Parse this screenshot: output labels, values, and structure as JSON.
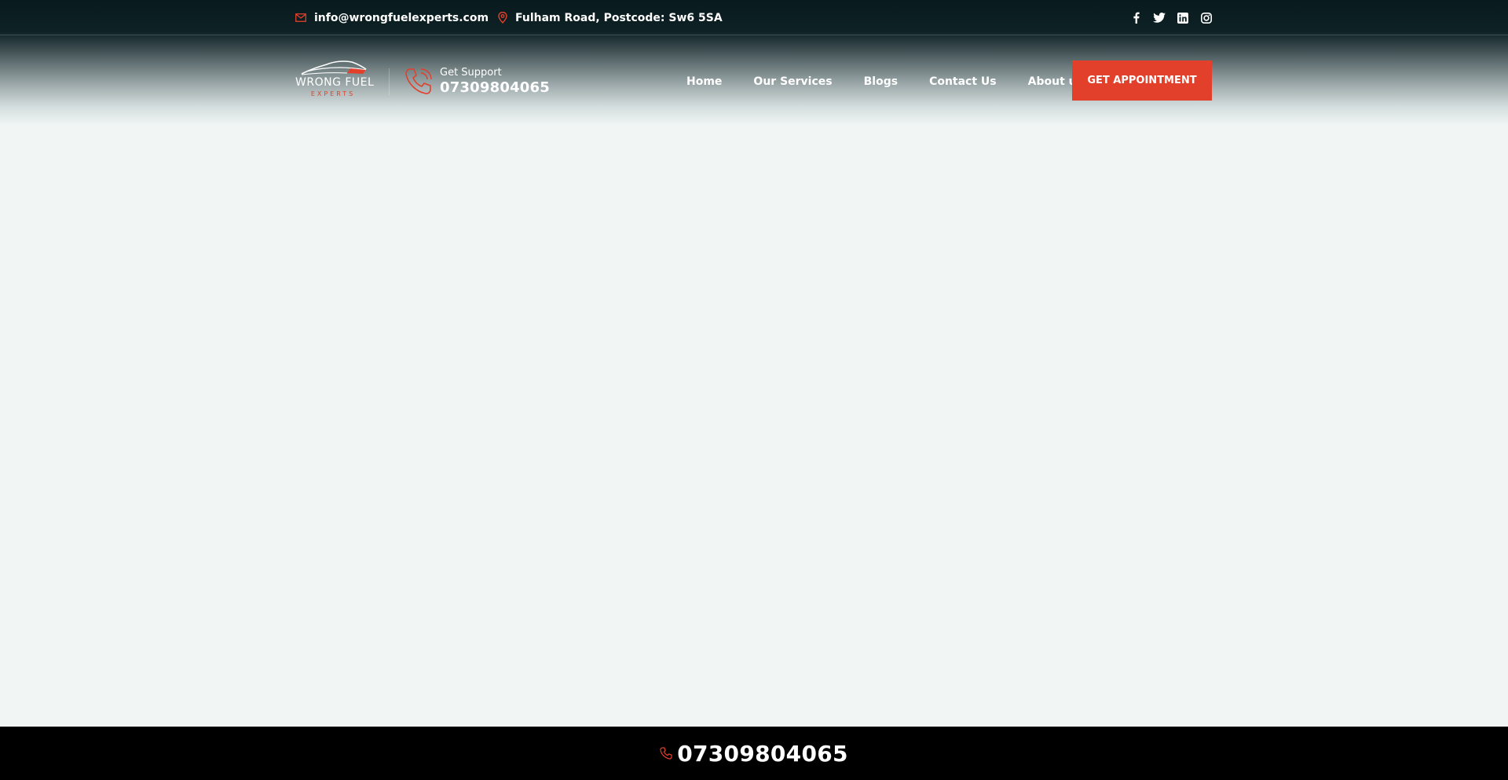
{
  "topbar": {
    "email": "info@wrongfuelexperts.com",
    "address": "Fulham Road, Postcode: Sw6 5SA",
    "social": [
      "facebook-icon",
      "twitter-icon",
      "linkedin-icon",
      "instagram-icon"
    ]
  },
  "logo": {
    "line1": "WRONG FUEL",
    "line2": "EXPERTS"
  },
  "support": {
    "label": "Get Support",
    "number": "07309804065"
  },
  "nav": {
    "items": [
      {
        "label": "Home"
      },
      {
        "label": "Our Services"
      },
      {
        "label": "Blogs"
      },
      {
        "label": "Contact Us"
      },
      {
        "label": "About us"
      }
    ]
  },
  "cta": {
    "label": "GET APPOINTMENT"
  },
  "callbar": {
    "number": "07309804065"
  },
  "colors": {
    "accent": "#e3402b",
    "header_dark": "#081a1d",
    "page_bg": "#f1f6f5",
    "callbar_bg": "#000000"
  }
}
